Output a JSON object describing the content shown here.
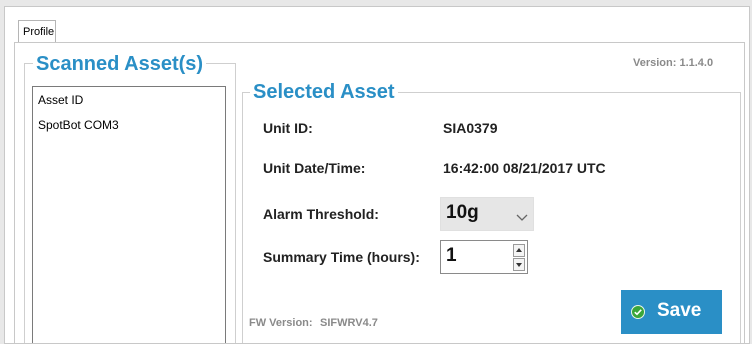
{
  "tabs": [
    {
      "label": "Profile"
    }
  ],
  "version_text": "Version: 1.1.4.0",
  "scanned": {
    "title": "Scanned Asset(s)",
    "items": [
      "Asset ID",
      "SpotBot COM3"
    ]
  },
  "selected": {
    "title": "Selected Asset",
    "unit_id_label": "Unit ID:",
    "unit_id_value": "SIA0379",
    "unit_datetime_label": "Unit Date/Time:",
    "unit_datetime_value": "16:42:00 08/21/2017 UTC",
    "alarm_label": "Alarm Threshold:",
    "alarm_value": "10g",
    "summary_label": "Summary Time (hours):",
    "summary_value": "1",
    "fw_label": "FW Version:",
    "fw_value": "SIFWRV4.7",
    "save_label": "Save"
  },
  "icons": {
    "select_arrow": "chevron-down-icon",
    "spin_up": "triangle-up-icon",
    "spin_down": "triangle-down-icon",
    "save": "check-circle-icon"
  },
  "colors": {
    "accent": "#2a8fc6",
    "save_button": "#2a8fc6",
    "check_circle": "#3aa63a"
  }
}
